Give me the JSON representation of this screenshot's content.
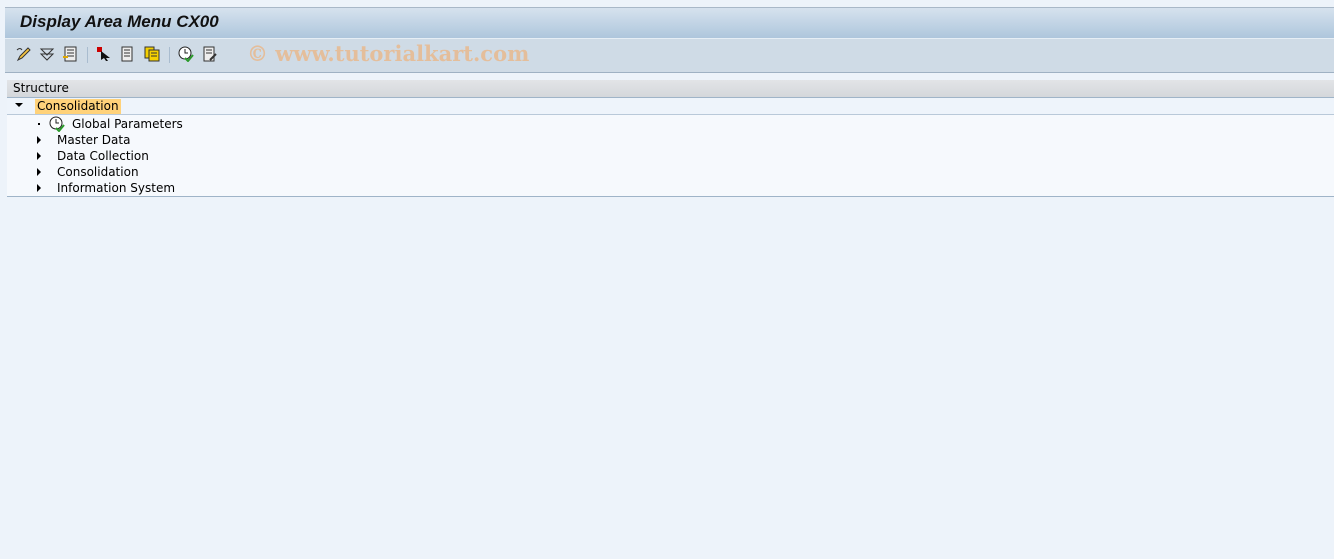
{
  "window": {
    "title": "Display Area Menu CX00"
  },
  "toolbar": {
    "buttons": [
      {
        "icon": "edit-pencil-icon"
      },
      {
        "icon": "collapse-icon"
      },
      {
        "icon": "add-menu-icon"
      },
      {
        "icon": "select-cursor-icon"
      },
      {
        "icon": "document-icon"
      },
      {
        "icon": "copy-documents-icon"
      },
      {
        "icon": "execute-clock-icon"
      },
      {
        "icon": "document-edit-icon"
      }
    ],
    "watermark": "© www.tutorialkart.com"
  },
  "tree": {
    "header": "Structure",
    "root": {
      "label": "Consolidation",
      "expanded": true,
      "highlight_color": "#ffd27a"
    },
    "children": [
      {
        "label": "Global Parameters",
        "type": "transaction",
        "icon": "clock-check-icon"
      },
      {
        "label": "Master Data",
        "type": "folder"
      },
      {
        "label": "Data Collection",
        "type": "folder"
      },
      {
        "label": "Consolidation",
        "type": "folder"
      },
      {
        "label": "Information System",
        "type": "folder"
      }
    ]
  }
}
